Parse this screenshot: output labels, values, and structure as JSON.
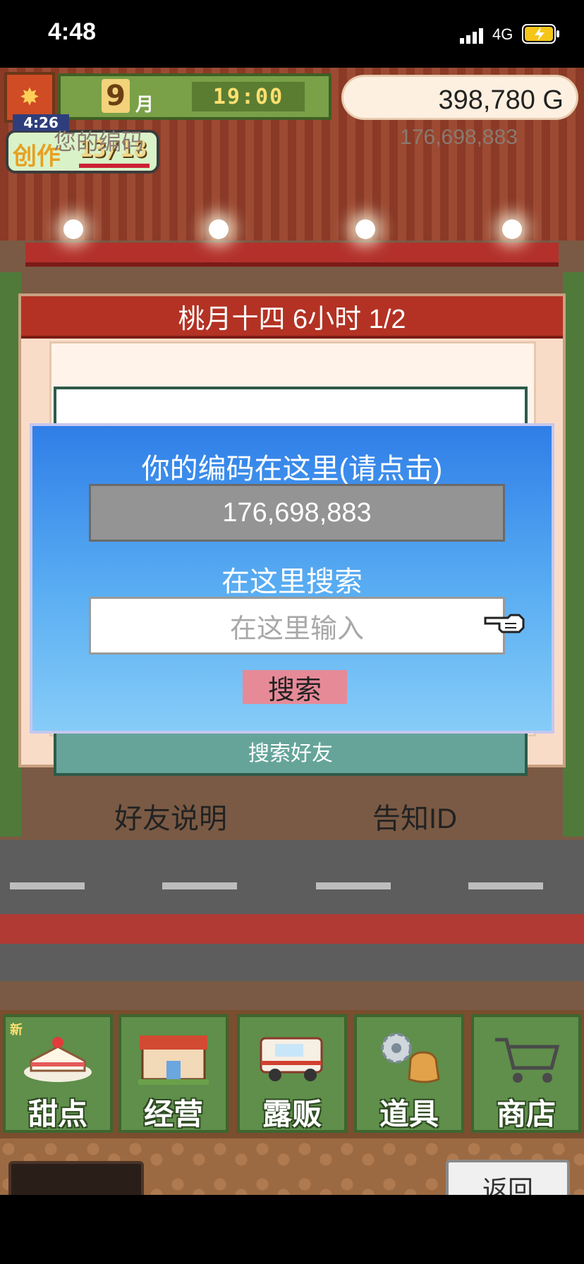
{
  "status_bar": {
    "time": "4:48",
    "network": "4G"
  },
  "hud": {
    "month_number": "9",
    "month_label": "月",
    "clock": "19:00",
    "gold": "398,780 G",
    "create_timer": "4:26",
    "create_label": "创作",
    "create_count": "13/18"
  },
  "friend_panel": {
    "header": "桃月十四  6小时 1/2",
    "your_code_label": "您的编码",
    "your_code_value": "176,698,883",
    "search_friend": "搜索好友",
    "friend_help": "好友说明",
    "notify_id": "告知ID"
  },
  "search_dialog": {
    "title": "你的编码在这里(请点击)",
    "code": "176,698,883",
    "search_label": "在这里搜索",
    "input_placeholder": "在这里输入",
    "search_button": "搜索"
  },
  "menu": {
    "new_badge": "新",
    "items": [
      {
        "label": "甜点",
        "icon": "cake-icon"
      },
      {
        "label": "经营",
        "icon": "shop-building-icon"
      },
      {
        "label": "露贩",
        "icon": "food-truck-icon"
      },
      {
        "label": "道具",
        "icon": "gear-bag-icon"
      },
      {
        "label": "商店",
        "icon": "shopping-cart-icon"
      }
    ]
  },
  "back_button": "返回",
  "colors": {
    "dialog_blue": "#2f7ee8",
    "header_red": "#b33224",
    "search_pink": "#e68a98",
    "menu_green": "#5f8f4a"
  }
}
